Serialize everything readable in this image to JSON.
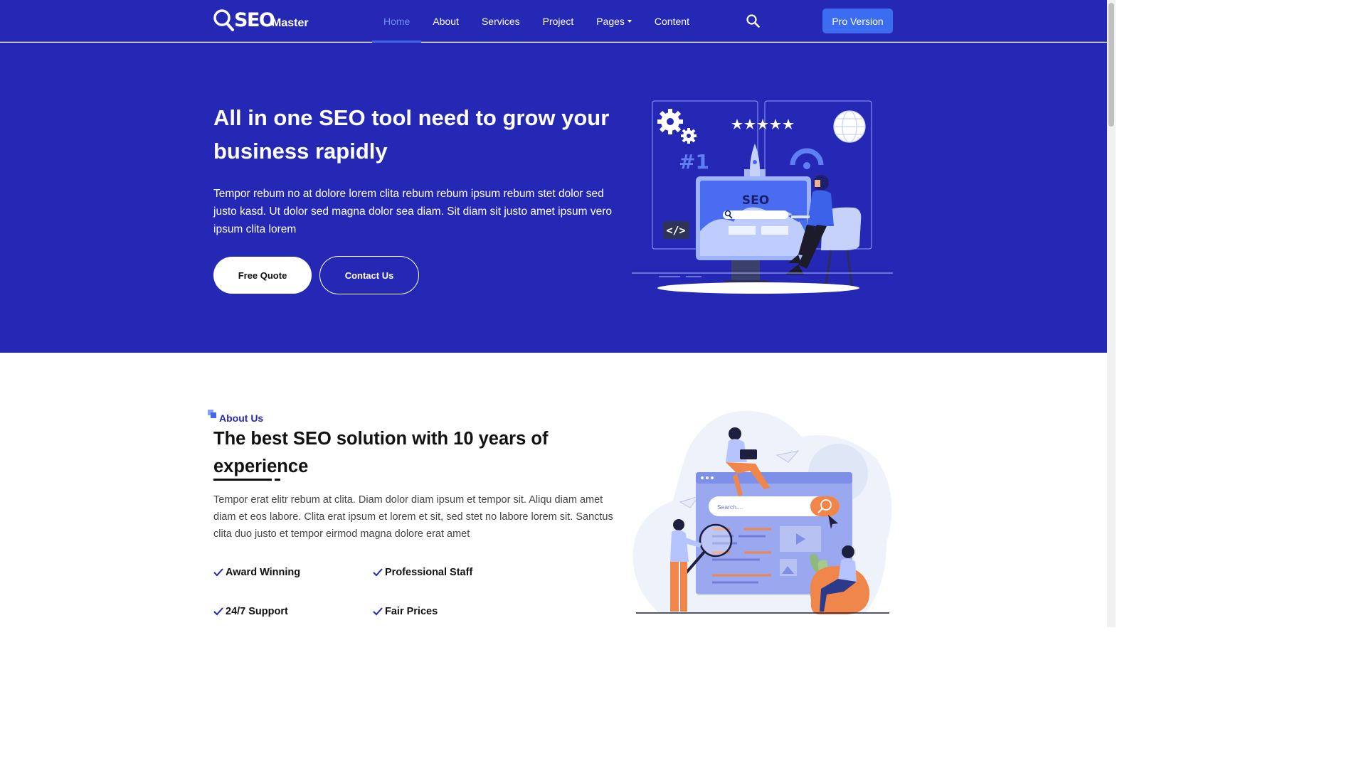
{
  "brand": {
    "name_main": "SEO",
    "name_sub": "Master"
  },
  "nav": {
    "items": [
      {
        "label": "Home",
        "active": true
      },
      {
        "label": "About"
      },
      {
        "label": "Services"
      },
      {
        "label": "Project"
      },
      {
        "label": "Pages",
        "has_dropdown": true
      },
      {
        "label": "Content"
      }
    ],
    "search_icon": "search-icon",
    "pro_button": "Pro Version"
  },
  "hero": {
    "title": "All in one SEO tool need to grow your business rapidly",
    "text": "Tempor rebum no at dolore lorem clita rebum rebum ipsum rebum stet dolor sed justo kasd. Ut dolor sed magna dolor sea diam. Sit diam sit justo amet ipsum vero ipsum clita lorem",
    "btn_quote": "Free Quote",
    "btn_contact": "Contact Us",
    "illustration": {
      "rank": "#1",
      "screen_label": "SEO",
      "code_tag": "</>"
    }
  },
  "about": {
    "tag": "About Us",
    "title": "The best SEO solution with 10 years of experience",
    "text": "Tempor erat elitr rebum at clita. Diam dolor diam ipsum et tempor sit. Aliqu diam amet diam et eos labore. Clita erat ipsum et lorem et sit, sed stet no labore lorem sit. Sanctus clita duo justo et tempor eirmod magna dolore erat amet",
    "features": [
      "Award Winning",
      "Professional Staff",
      "24/7 Support",
      "Fair Prices"
    ],
    "illustration": {
      "search_placeholder": "Search...."
    }
  },
  "colors": {
    "primary": "#2528b4",
    "accent": "#3c6cf0",
    "active_link": "#6f8df5"
  }
}
